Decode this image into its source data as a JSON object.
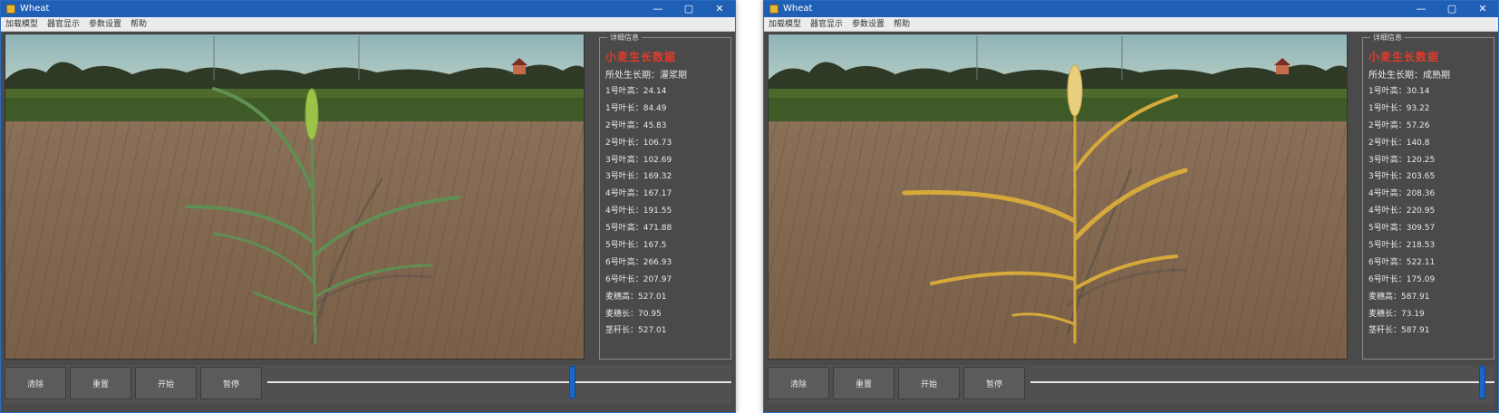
{
  "windows": [
    {
      "title": "Wheat",
      "menu": [
        "加载模型",
        "器官显示",
        "参数设置",
        "帮助"
      ],
      "info_panel": {
        "legend": "详细信息",
        "heading": "小麦生长数据",
        "stage": "所处生长期：灌浆期",
        "rows": [
          "1号叶高：24.14",
          "1号叶长：84.49",
          "2号叶高：45.83",
          "2号叶长：106.73",
          "3号叶高：102.69",
          "3号叶长：169.32",
          "4号叶高：167.17",
          "4号叶长：191.55",
          "5号叶高：471.88",
          "5号叶长：167.5",
          "6号叶高：266.93",
          "6号叶长：207.97",
          "麦穗高：527.01",
          "麦穗长：70.95",
          "茎秆长：527.01"
        ]
      },
      "buttons": [
        "清除",
        "重置",
        "开始",
        "暂停"
      ],
      "slider_value": 0.66,
      "plant_color": "#5f8f52",
      "ear_color": "#9cc24a"
    },
    {
      "title": "Wheat",
      "menu": [
        "加载模型",
        "器官显示",
        "参数设置",
        "帮助"
      ],
      "info_panel": {
        "legend": "详细信息",
        "heading": "小麦生长数据",
        "stage": "所处生长期：成熟期",
        "rows": [
          "1号叶高：30.14",
          "1号叶长：93.22",
          "2号叶高：57.26",
          "2号叶长：140.8",
          "3号叶高：120.25",
          "3号叶长：203.65",
          "4号叶高：208.36",
          "4号叶长：220.95",
          "5号叶高：309.57",
          "5号叶长：218.53",
          "6号叶高：522.11",
          "6号叶长：175.09",
          "麦穗高：587.91",
          "麦穗长：73.19",
          "茎秆长：587.91"
        ]
      },
      "buttons": [
        "清除",
        "重置",
        "开始",
        "暂停"
      ],
      "slider_value": 0.98,
      "plant_color": "#d6aa3a",
      "ear_color": "#e7cf7d"
    }
  ],
  "window_controls": [
    "—",
    "▢",
    "✕"
  ]
}
